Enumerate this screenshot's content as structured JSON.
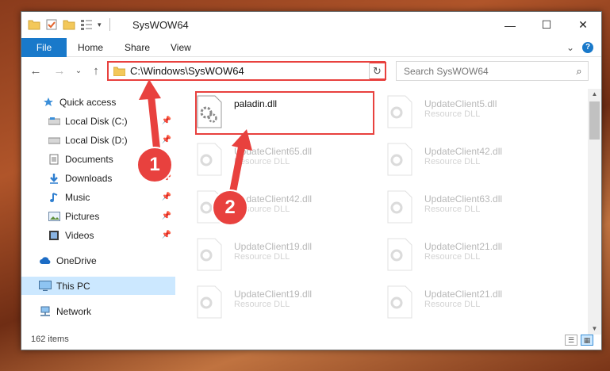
{
  "window": {
    "title": "SysWOW64",
    "minimize": "—",
    "maximize": "☐",
    "close": "✕"
  },
  "ribbon": {
    "file": "File",
    "home": "Home",
    "share": "Share",
    "view": "View",
    "expand": "⌄",
    "help": "?"
  },
  "nav": {
    "back": "←",
    "forward": "→",
    "recent": "⌄",
    "up": "↑",
    "address": "C:\\Windows\\SysWOW64",
    "address_drop": "⌄",
    "refresh": "↻",
    "search_placeholder": "Search SysWOW64",
    "search_icon": "⌕"
  },
  "sidebar": {
    "items": [
      {
        "label": "Quick access",
        "icon": "star-icon"
      },
      {
        "label": "Local Disk (C:)",
        "icon": "drive-icon"
      },
      {
        "label": "Local Disk (D:)",
        "icon": "drive-icon"
      },
      {
        "label": "Documents",
        "icon": "documents-icon"
      },
      {
        "label": "Downloads",
        "icon": "download-icon"
      },
      {
        "label": "Music",
        "icon": "music-icon"
      },
      {
        "label": "Pictures",
        "icon": "pictures-icon"
      },
      {
        "label": "Videos",
        "icon": "videos-icon"
      },
      {
        "label": "OneDrive",
        "icon": "cloud-icon"
      },
      {
        "label": "This PC",
        "icon": "monitor-icon"
      },
      {
        "label": "Network",
        "icon": "network-icon"
      }
    ],
    "pin": "📌"
  },
  "files": [
    {
      "name": "paladin.dll",
      "type": ""
    },
    {
      "name": "UpdateClient5.dll",
      "type": "Resource DLL"
    },
    {
      "name": "UpdateClient65.dll",
      "type": "Resource DLL"
    },
    {
      "name": "UpdateClient42.dll",
      "type": "Resource DLL"
    },
    {
      "name": "UpdateClient42.dll",
      "type": "Resource DLL"
    },
    {
      "name": "UpdateClient63.dll",
      "type": "Resource DLL"
    },
    {
      "name": "UpdateClient19.dll",
      "type": "Resource DLL"
    },
    {
      "name": "UpdateClient21.dll",
      "type": "Resource DLL"
    },
    {
      "name": "UpdateClient19.dll",
      "type": "Resource DLL"
    },
    {
      "name": "UpdateClient21.dll",
      "type": "Resource DLL"
    }
  ],
  "status": {
    "count": "162 items"
  },
  "callouts": {
    "one": "1",
    "two": "2"
  },
  "colors": {
    "accent": "#1979ca",
    "highlight": "#e8413e",
    "selected": "#cce8ff"
  }
}
